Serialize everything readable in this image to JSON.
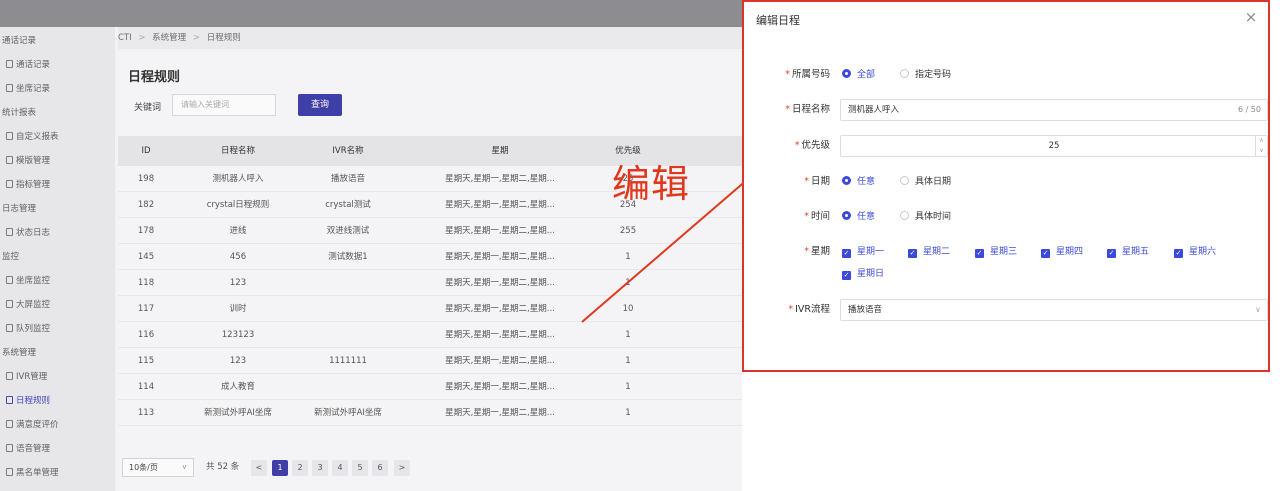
{
  "sidebar": {
    "items": [
      {
        "label": "通话记录",
        "kind": "group",
        "icon": "none"
      },
      {
        "label": "通话记录",
        "kind": "item",
        "icon": "doc-icon"
      },
      {
        "label": "坐席记录",
        "kind": "item",
        "icon": "doc-icon"
      },
      {
        "label": "统计报表",
        "kind": "group",
        "icon": "none"
      },
      {
        "label": "自定义报表",
        "kind": "item",
        "icon": "doc-icon"
      },
      {
        "label": "模版管理",
        "kind": "item",
        "icon": "doc-icon"
      },
      {
        "label": "指标管理",
        "kind": "item",
        "icon": "doc-icon"
      },
      {
        "label": "日志管理",
        "kind": "group",
        "icon": "none"
      },
      {
        "label": "状态日志",
        "kind": "item",
        "icon": "doc-icon"
      },
      {
        "label": "监控",
        "kind": "group",
        "icon": "none"
      },
      {
        "label": "坐席监控",
        "kind": "item",
        "icon": "doc-icon"
      },
      {
        "label": "大屏监控",
        "kind": "item",
        "icon": "doc-icon"
      },
      {
        "label": "队列监控",
        "kind": "item",
        "icon": "doc-icon"
      },
      {
        "label": "系统管理",
        "kind": "group",
        "icon": "none"
      },
      {
        "label": "IVR管理",
        "kind": "item",
        "icon": "doc-icon"
      },
      {
        "label": "日程规则",
        "kind": "item",
        "icon": "doc-icon",
        "active": true
      },
      {
        "label": "满意度评价",
        "kind": "item",
        "icon": "doc-icon"
      },
      {
        "label": "语音管理",
        "kind": "item",
        "icon": "doc-icon"
      },
      {
        "label": "黑名单管理",
        "kind": "item",
        "icon": "doc-icon"
      }
    ]
  },
  "breadcrumb": [
    "CTI",
    "系统管理",
    "日程规则"
  ],
  "page": {
    "title": "日程规则",
    "keyword_label": "关键词",
    "keyword_placeholder": "请输入关键词",
    "query_button": "查询"
  },
  "table": {
    "headers": [
      "ID",
      "日程名称",
      "IVR名称",
      "星期",
      "优先级"
    ],
    "rows": [
      [
        "198",
        "测机器人呼入",
        "播放语音",
        "星期天,星期一,星期二,星期...",
        "25"
      ],
      [
        "182",
        "crystal日程规则",
        "crystal测试",
        "星期天,星期一,星期二,星期...",
        "254"
      ],
      [
        "178",
        "进线",
        "双进线测试",
        "星期天,星期一,星期二,星期...",
        "255"
      ],
      [
        "145",
        "456",
        "测试数据1",
        "星期天,星期一,星期二,星期...",
        "1"
      ],
      [
        "118",
        "123",
        "",
        "星期天,星期一,星期二,星期...",
        "1"
      ],
      [
        "117",
        "训时",
        "",
        "星期天,星期一,星期二,星期...",
        "10"
      ],
      [
        "116",
        "123123",
        "",
        "星期天,星期一,星期二,星期...",
        "1"
      ],
      [
        "115",
        "123",
        "1111111",
        "星期天,星期一,星期二,星期...",
        "1"
      ],
      [
        "114",
        "成人教育",
        "",
        "星期天,星期一,星期二,星期...",
        "1"
      ],
      [
        "113",
        "新测试外呼AI坐席",
        "新测试外呼AI坐席",
        "星期天,星期一,星期二,星期...",
        "1"
      ]
    ]
  },
  "pager": {
    "page_size": "10条/页",
    "total": "共 52 条",
    "pages": [
      "1",
      "2",
      "3",
      "4",
      "5",
      "6"
    ],
    "current": "1",
    "prev": "<",
    "next": ">"
  },
  "annotation": {
    "text": "编辑",
    "color": "#e0381c"
  },
  "dialog": {
    "title": "编辑日程",
    "close": "×",
    "fields": {
      "number": {
        "label": "所属号码",
        "options": [
          "全部",
          "指定号码"
        ],
        "selected": "全部"
      },
      "name": {
        "label": "日程名称",
        "value": "测机器人呼入",
        "count": "6 / 50"
      },
      "priority": {
        "label": "优先级",
        "value": "25"
      },
      "date": {
        "label": "日期",
        "options": [
          "任意",
          "具体日期"
        ],
        "selected": "任意"
      },
      "time": {
        "label": "时间",
        "options": [
          "任意",
          "具体时间"
        ],
        "selected": "任意"
      },
      "weekday": {
        "label": "星期",
        "options": [
          "星期一",
          "星期二",
          "星期三",
          "星期四",
          "星期五",
          "星期六",
          "星期日"
        ],
        "checked": [
          "星期一",
          "星期二",
          "星期三",
          "星期四",
          "星期五",
          "星期六",
          "星期日"
        ]
      },
      "ivr": {
        "label": "IVR流程",
        "value": "播放语音"
      }
    }
  },
  "colors": {
    "accent": "#3d4ad8",
    "dialog_border": "#d9352b",
    "sidebar_active": "#4444bb"
  }
}
